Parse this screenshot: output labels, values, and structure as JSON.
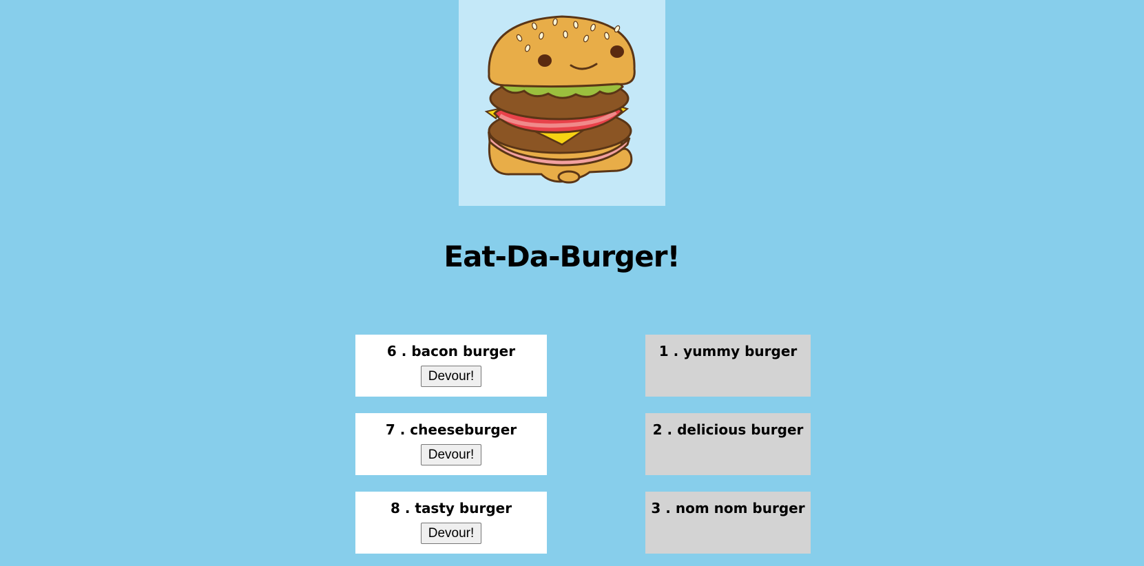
{
  "app": {
    "title": "Eat-Da-Burger!",
    "logo_icon": "burger-mascot-icon"
  },
  "colors": {
    "background": "#87ceeb",
    "logo_background": "#c4e8f8",
    "uneaten_card": "#ffffff",
    "devoured_card": "#d3d3d3"
  },
  "uneaten": [
    {
      "name": "6 . bacon burger",
      "button": "Devour!"
    },
    {
      "name": "7 . cheeseburger",
      "button": "Devour!"
    },
    {
      "name": "8 . tasty burger",
      "button": "Devour!"
    }
  ],
  "devoured": [
    {
      "name": "1 . yummy burger"
    },
    {
      "name": "2 . delicious burger"
    },
    {
      "name": "3 . nom nom burger"
    }
  ]
}
